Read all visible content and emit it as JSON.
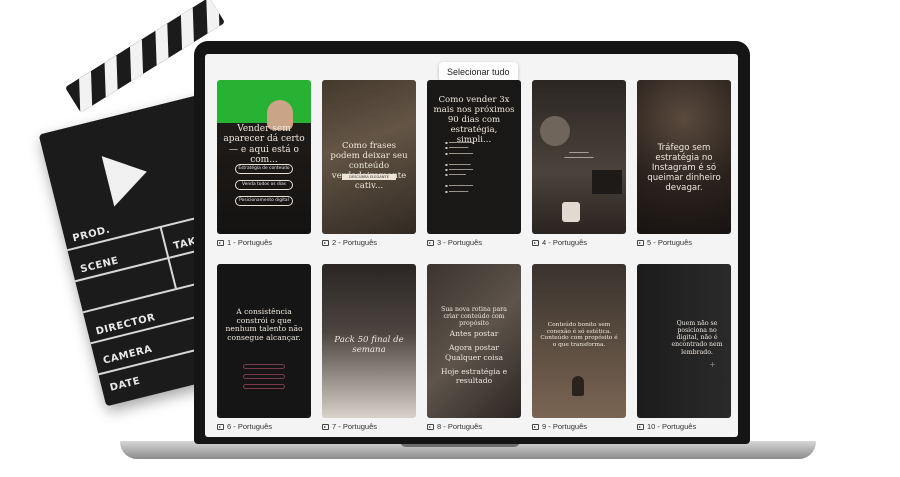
{
  "clapperboard": {
    "labels": {
      "prod": "PROD.",
      "scene": "SCENE",
      "take": "TAKE",
      "director": "DIRECTOR",
      "camera": "CAMERA",
      "date": "DATE"
    }
  },
  "screen": {
    "select_all_label": "Selecionar tudo",
    "cards": [
      {
        "label": "1 - Português",
        "title": "Vender sem aparecer dá certo — e aqui está o com...",
        "pills": [
          "Estratégia de conteúdo",
          "Venda todos os dias",
          "Posicionamento digital"
        ]
      },
      {
        "label": "2 - Português",
        "title": "Como frases podem deixar seu conteúdo verdadeiramente cativ...",
        "badge": "DESCUBRA ELEGANTE"
      },
      {
        "label": "3 - Português",
        "title": "Como vender 3x mais nos próximos 90 dias com estratégia, simpli..."
      },
      {
        "label": "4 - Português",
        "title": ""
      },
      {
        "label": "5 - Português",
        "title": "Tráfego sem estratégia no Instagram é só queimar dinheiro devagar."
      },
      {
        "label": "6 - Português",
        "title": "A consistência constrói o que nenhum talento não consegue alcançar."
      },
      {
        "label": "7 - Português",
        "title": "Pack 50 final de semana"
      },
      {
        "label": "8 - Português",
        "title": "Sua nova rotina para criar conteúdo com propósito",
        "lines": [
          "Antes postar",
          "Agora postar",
          "Qualquer coisa",
          "Hoje estratégia e resultado"
        ]
      },
      {
        "label": "9 - Português",
        "title": "Conteúdo bonito sem conexão é só estética. Conteúdo com propósito é o que transforma."
      },
      {
        "label": "10 - Português",
        "title": "Quem não se posiciona no digital, não é encontrado nem lembrado."
      }
    ]
  },
  "colors": {
    "screen_bg": "#f4f4f4",
    "bezel": "#151515",
    "thumb_dark": "#1d1a18",
    "green_screen": "#27b233"
  }
}
